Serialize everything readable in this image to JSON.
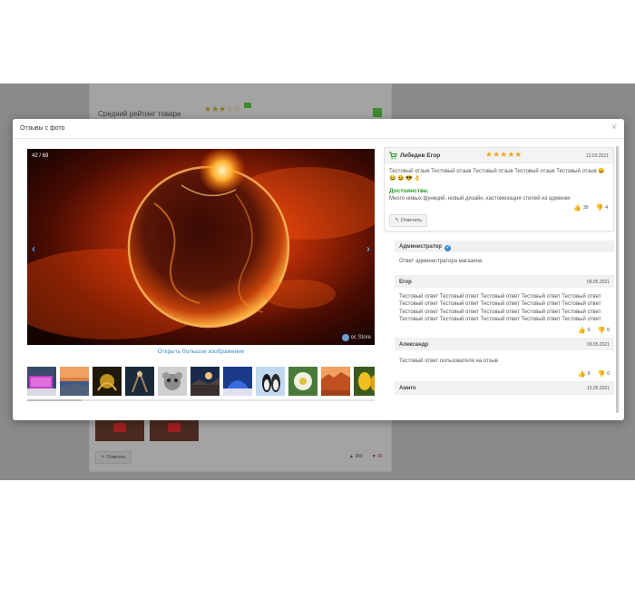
{
  "background_page": {
    "rating_label": "Средний рейтинг товара",
    "reply_label": "Ответить",
    "likes": "399",
    "dislikes": "16"
  },
  "modal": {
    "title": "Отзывы с фото",
    "close_icon": "×"
  },
  "viewer": {
    "counter": "42 / 69",
    "prev_icon": "‹",
    "next_icon": "›",
    "watermark": "oc Store",
    "open_large_label": "Открыть большое изображение",
    "thumbnail_count": 11,
    "image_subject": "solar eclipse / burning planet"
  },
  "review": {
    "author": "Лебедев Егор",
    "rating": 5,
    "stars": "★★★★★",
    "date": "13.03.2021",
    "text": "Тестовый отзыв Тестовый отзыв Тестовый отзыв Тестовый отзыв Тестовый отзыв 😄 😂 😆 😎 👌",
    "pros_label": "Достоинства:",
    "pros_text": "Много новых функций, новый дизайн, кастомизация стилей из админки",
    "likes": "30",
    "dislikes": "4",
    "reply_label": "Ответить"
  },
  "answers": [
    {
      "author": "Администратор",
      "verified": true,
      "date": "",
      "text": "Ответ администратора магазина",
      "likes": "",
      "dislikes": ""
    },
    {
      "author": "Егор",
      "verified": false,
      "date": "09.05.2021",
      "text": "Тестовый ответ Тестовый ответ Тестовый ответ Тестовый ответ Тестовый ответ Тестовый ответ Тестовый ответ Тестовый ответ Тестовый ответ Тестовый ответ Тестовый ответ Тестовый ответ Тестовый ответ Тестовый ответ Тестовый ответ Тестовый ответ Тестовый ответ Тестовый ответ Тестовый ответ Тестовый ответ",
      "likes": "0",
      "dislikes": "0"
    },
    {
      "author": "Александр",
      "verified": false,
      "date": "09.05.2021",
      "text": "Тестовый ответ пользователя на отзыв",
      "likes": "0",
      "dislikes": "0"
    },
    {
      "author": "Амиго",
      "verified": false,
      "date": "13.05.2021",
      "text": "",
      "likes": "",
      "dislikes": ""
    }
  ],
  "colors": {
    "accent": "#3b8ad0",
    "star": "#f5a623",
    "pros": "#2a9d2a",
    "like": "#3ca03c",
    "dislike": "#d04040"
  }
}
